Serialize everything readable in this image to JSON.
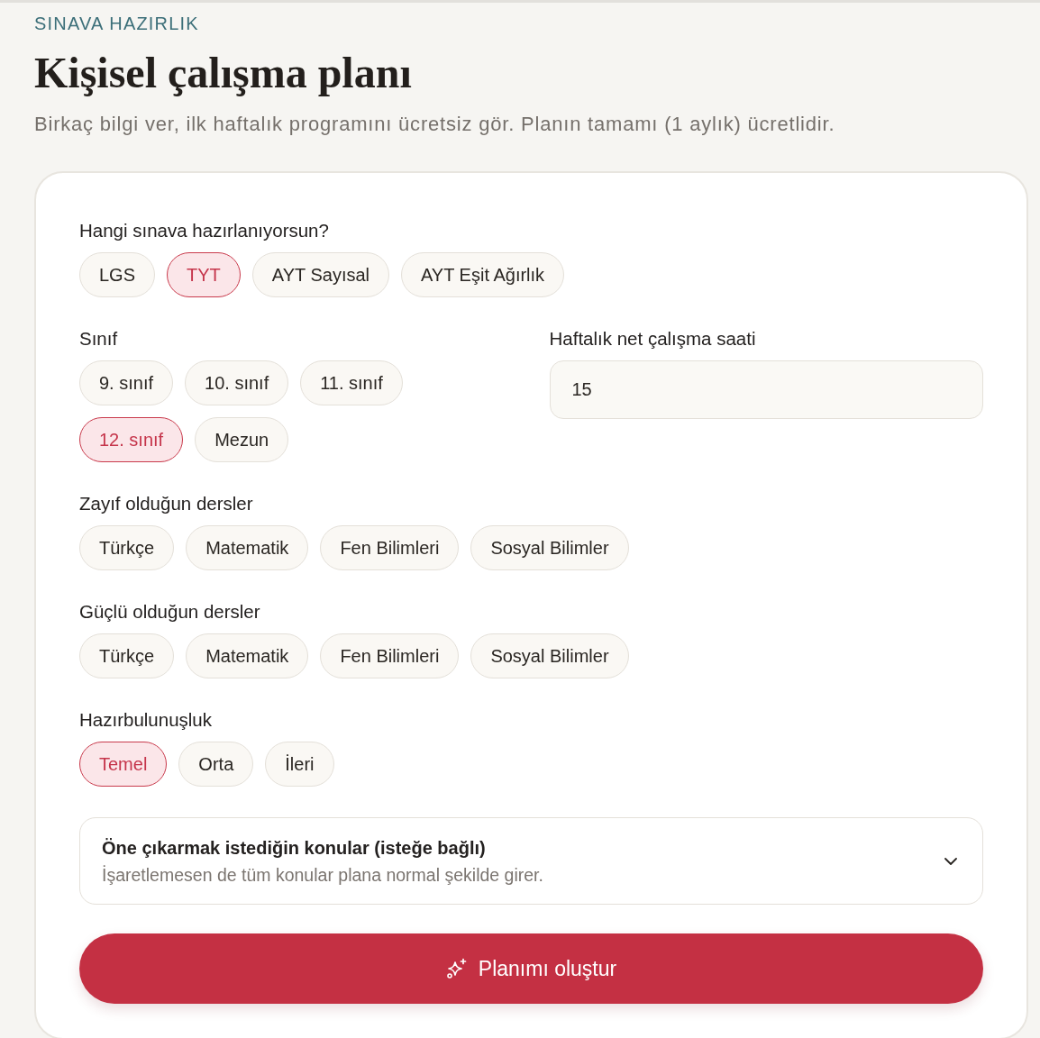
{
  "header": {
    "eyebrow": "SINAVA HAZIRLIK",
    "title": "Kişisel çalışma planı",
    "subtitle": "Birkaç bilgi ver, ilk haftalık programını ücretsiz gör. Planın tamamı (1 aylık) ücretlidir."
  },
  "form": {
    "exam": {
      "label": "Hangi sınava hazırlanıyorsun?",
      "options": [
        {
          "label": "LGS",
          "selected": false
        },
        {
          "label": "TYT",
          "selected": true
        },
        {
          "label": "AYT Sayısal",
          "selected": false
        },
        {
          "label": "AYT Eşit Ağırlık",
          "selected": false
        }
      ]
    },
    "grade": {
      "label": "Sınıf",
      "options": [
        {
          "label": "9. sınıf",
          "selected": false
        },
        {
          "label": "10. sınıf",
          "selected": false
        },
        {
          "label": "11. sınıf",
          "selected": false
        },
        {
          "label": "12. sınıf",
          "selected": true
        },
        {
          "label": "Mezun",
          "selected": false
        }
      ]
    },
    "weekly_hours": {
      "label": "Haftalık net çalışma saati",
      "value": "15"
    },
    "weak_subjects": {
      "label": "Zayıf olduğun dersler",
      "options": [
        {
          "label": "Türkçe",
          "selected": false
        },
        {
          "label": "Matematik",
          "selected": false
        },
        {
          "label": "Fen Bilimleri",
          "selected": false
        },
        {
          "label": "Sosyal Bilimler",
          "selected": false
        }
      ]
    },
    "strong_subjects": {
      "label": "Güçlü olduğun dersler",
      "options": [
        {
          "label": "Türkçe",
          "selected": false
        },
        {
          "label": "Matematik",
          "selected": false
        },
        {
          "label": "Fen Bilimleri",
          "selected": false
        },
        {
          "label": "Sosyal Bilimler",
          "selected": false
        }
      ]
    },
    "readiness": {
      "label": "Hazırbulunuşluk",
      "options": [
        {
          "label": "Temel",
          "selected": true
        },
        {
          "label": "Orta",
          "selected": false
        },
        {
          "label": "İleri",
          "selected": false
        }
      ]
    },
    "topics": {
      "title": "Öne çıkarmak istediğin konular (isteğe bağlı)",
      "description": "İşaretlemesen de tüm konular plana normal şekilde girer.",
      "expanded": false
    },
    "submit_button": {
      "label": "Planımı oluştur"
    }
  }
}
